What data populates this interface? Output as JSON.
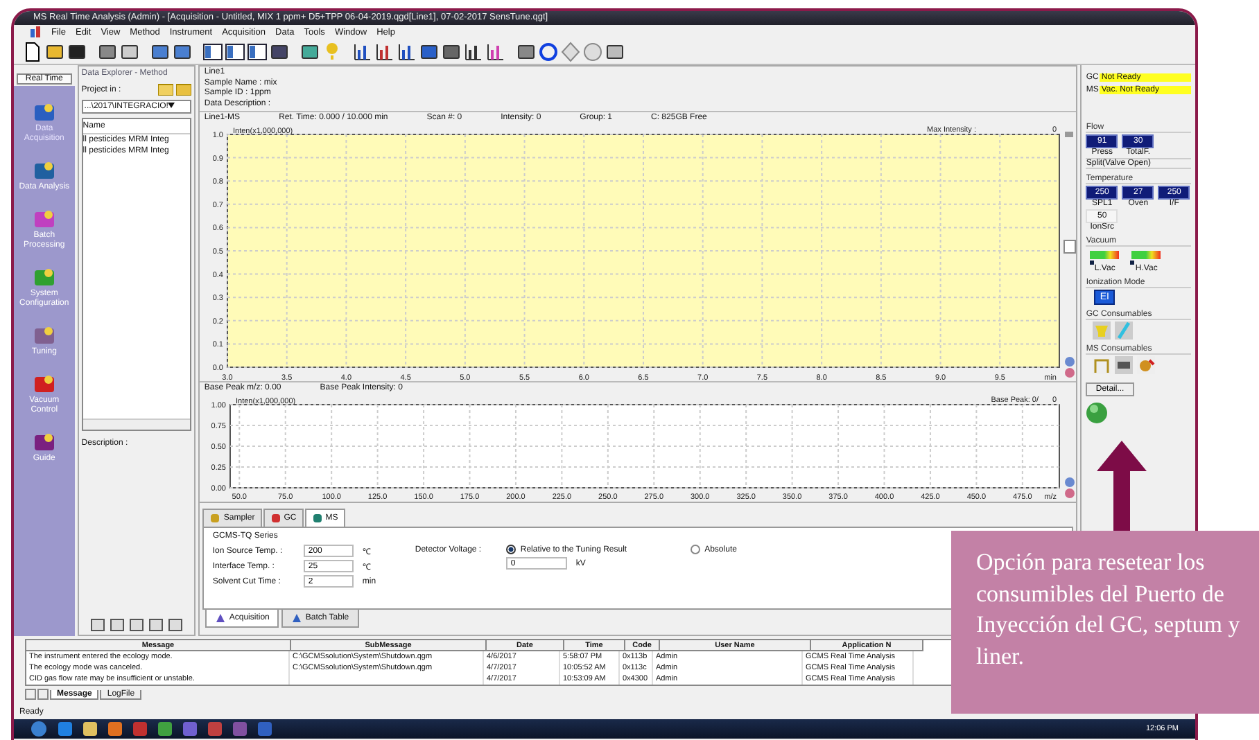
{
  "window": {
    "title": "MS Real Time Analysis (Admin) - [Acquisition - Untitled, MIX 1 ppm+ D5+TPP 06-04-2019.qgd[Line1], 07-02-2017 SensTune.qgt]"
  },
  "menu": [
    "File",
    "Edit",
    "View",
    "Method",
    "Instrument",
    "Acquisition",
    "Data",
    "Tools",
    "Window",
    "Help"
  ],
  "sidebar": {
    "title": "Real Time",
    "items": [
      {
        "label": "Data Acquisition",
        "selected": true
      },
      {
        "label": "Data Analysis",
        "selected": false
      },
      {
        "label": "Batch Processing",
        "selected": false
      },
      {
        "label": "System Configuration",
        "selected": false
      },
      {
        "label": "Tuning",
        "selected": false
      },
      {
        "label": "Vacuum Control",
        "selected": false
      },
      {
        "label": "Guide",
        "selected": false
      }
    ]
  },
  "explorer": {
    "title": "Data Explorer - Method",
    "project_label": "Project in :",
    "project": "...\\2017\\INTEGRACIO!",
    "column": "Name",
    "files": [
      "ll pesticides MRM Integ",
      "ll pesticides MRM Integ"
    ],
    "description_label": "Description :"
  },
  "info": [
    "Line1",
    "Sample Name : mix",
    "Sample ID : 1ppm",
    "Data Description :"
  ],
  "status_row": [
    "Line1-MS",
    "Ret. Time: 0.000 / 10.000 min",
    "Scan #: 0",
    "Intensity: 0",
    "Group: 1",
    "C:  825GB Free"
  ],
  "chromatogram": {
    "right_label": "Max Intensity :",
    "right_value": "0",
    "chart_data": {
      "type": "line",
      "grid": true,
      "xlabel": "min",
      "ylabel": "Inten(x1,000,000)",
      "xlim": [
        3,
        10
      ],
      "ylim": [
        0,
        1
      ],
      "xticks": [
        {
          "value": 3,
          "label": "3.0"
        },
        {
          "value": 3.5,
          "label": "3.5"
        },
        {
          "value": 4,
          "label": "4.0"
        },
        {
          "value": 4.5,
          "label": "4.5"
        },
        {
          "value": 5,
          "label": "5.0"
        },
        {
          "value": 5.5,
          "label": "5.5"
        },
        {
          "value": 6,
          "label": "6.0"
        },
        {
          "value": 6.5,
          "label": "6.5"
        },
        {
          "value": 7,
          "label": "7.0"
        },
        {
          "value": 7.5,
          "label": "7.5"
        },
        {
          "value": 8,
          "label": "8.0"
        },
        {
          "value": 8.5,
          "label": "8.5"
        },
        {
          "value": 9,
          "label": "9.0"
        },
        {
          "value": 9.5,
          "label": "9.5"
        }
      ],
      "yticks": [
        {
          "value": 0,
          "label": "0.0"
        },
        {
          "value": 0.1,
          "label": "0.1"
        },
        {
          "value": 0.2,
          "label": "0.2"
        },
        {
          "value": 0.3,
          "label": "0.3"
        },
        {
          "value": 0.4,
          "label": "0.4"
        },
        {
          "value": 0.5,
          "label": "0.5"
        },
        {
          "value": 0.6,
          "label": "0.6"
        },
        {
          "value": 0.7,
          "label": "0.7"
        },
        {
          "value": 0.8,
          "label": "0.8"
        },
        {
          "value": 0.9,
          "label": "0.9"
        },
        {
          "value": 1,
          "label": "1.0"
        }
      ]
    }
  },
  "spectrum_header": [
    "Base Peak m/z: 0.00",
    "Base Peak Intensity: 0"
  ],
  "spectrum": {
    "right_label": "Base Peak: 0/",
    "right_value": "0",
    "chart_data": {
      "type": "line",
      "grid": true,
      "xlabel": "m/z",
      "ylabel": "Inten(x1,000,000)",
      "xlim": [
        45,
        495
      ],
      "ylim": [
        0,
        1
      ],
      "xticks": [
        {
          "value": 50,
          "label": "50.0"
        },
        {
          "value": 75,
          "label": "75.0"
        },
        {
          "value": 100,
          "label": "100.0"
        },
        {
          "value": 125,
          "label": "125.0"
        },
        {
          "value": 150,
          "label": "150.0"
        },
        {
          "value": 175,
          "label": "175.0"
        },
        {
          "value": 200,
          "label": "200.0"
        },
        {
          "value": 225,
          "label": "225.0"
        },
        {
          "value": 250,
          "label": "250.0"
        },
        {
          "value": 275,
          "label": "275.0"
        },
        {
          "value": 300,
          "label": "300.0"
        },
        {
          "value": 325,
          "label": "325.0"
        },
        {
          "value": 350,
          "label": "350.0"
        },
        {
          "value": 375,
          "label": "375.0"
        },
        {
          "value": 400,
          "label": "400.0"
        },
        {
          "value": 425,
          "label": "425.0"
        },
        {
          "value": 450,
          "label": "450.0"
        },
        {
          "value": 475,
          "label": "475.0"
        }
      ],
      "yticks": [
        {
          "value": 0,
          "label": "0.00"
        },
        {
          "value": 0.25,
          "label": "0.25"
        },
        {
          "value": 0.5,
          "label": "0.50"
        },
        {
          "value": 0.75,
          "label": "0.75"
        },
        {
          "value": 1,
          "label": "1.00"
        }
      ]
    }
  },
  "method_tabs": [
    {
      "label": "Sampler",
      "selected": false
    },
    {
      "label": "GC",
      "selected": false
    },
    {
      "label": "MS",
      "selected": true
    }
  ],
  "ms_form": {
    "series": "GCMS-TQ Series",
    "fields": [
      {
        "label": "Ion Source Temp. :",
        "value": "200",
        "unit": "℃"
      },
      {
        "label": "Interface Temp. :",
        "value": "25",
        "unit": "℃"
      },
      {
        "label": "Solvent Cut Time :",
        "value": "2",
        "unit": "min"
      }
    ],
    "detector_label": "Detector Voltage :",
    "detector_options": [
      {
        "label": "Relative to the Tuning Result",
        "selected": true
      },
      {
        "label": "Absolute",
        "selected": false
      }
    ],
    "detector_value": "0",
    "detector_unit": "kV"
  },
  "bottom_tabs": [
    {
      "label": "Acquisition",
      "selected": true
    },
    {
      "label": "Batch Table",
      "selected": false
    }
  ],
  "monitor": {
    "status": [
      {
        "label": "GC",
        "value": "Not Ready"
      },
      {
        "label": "MS",
        "value": "Vac. Not Ready"
      }
    ],
    "flow_title": "Flow",
    "flow": [
      {
        "value": "91",
        "label": "Press"
      },
      {
        "value": "30",
        "label": "TotalF."
      }
    ],
    "split": "Split(Valve Open)",
    "temperature_title": "Temperature",
    "temperatures": [
      {
        "value": "250",
        "label": "SPL1"
      },
      {
        "value": "27",
        "label": "Oven"
      },
      {
        "value": "250",
        "label": "I/F"
      }
    ],
    "ion_source": {
      "value": "50",
      "label": "IonSrc"
    },
    "vacuum_title": "Vacuum",
    "vacuum": [
      {
        "label": "L.Vac",
        "level": 0.05
      },
      {
        "label": "H.Vac",
        "level": 0
      }
    ],
    "ionization_title": "Ionization Mode",
    "ionization": "EI",
    "gc_consumables_title": "GC Consumables",
    "ms_consumables_title": "MS Consumables",
    "detail_button": "Detail..."
  },
  "messages": {
    "columns": [
      "Message",
      "SubMessage",
      "Date",
      "Time",
      "Code",
      "User Name",
      "Application N"
    ],
    "rows": [
      [
        "The instrument entered the ecology mode.",
        "C:\\GCMSsolution\\System\\Shutdown.qgm",
        "4/6/2017",
        "5:58:07 PM",
        "0x113b",
        "Admin",
        "GCMS Real Time Analysis"
      ],
      [
        "The ecology mode was canceled.",
        "C:\\GCMSsolution\\System\\Shutdown.qgm",
        "4/7/2017",
        "10:05:52 AM",
        "0x113c",
        "Admin",
        "GCMS Real Time Analysis"
      ],
      [
        "CID gas flow rate may be insufficient or unstable.",
        "",
        "4/7/2017",
        "10:53:09 AM",
        "0x4300",
        "Admin",
        "GCMS Real Time Analysis"
      ]
    ],
    "tabs": [
      {
        "label": "Message",
        "selected": true
      },
      {
        "label": "LogFile",
        "selected": false
      }
    ]
  },
  "status_bar": "Ready",
  "clock": "12:06 PM",
  "callout": "Opción para resetear los consumibles del Puerto de Inyección del GC, septum y liner."
}
